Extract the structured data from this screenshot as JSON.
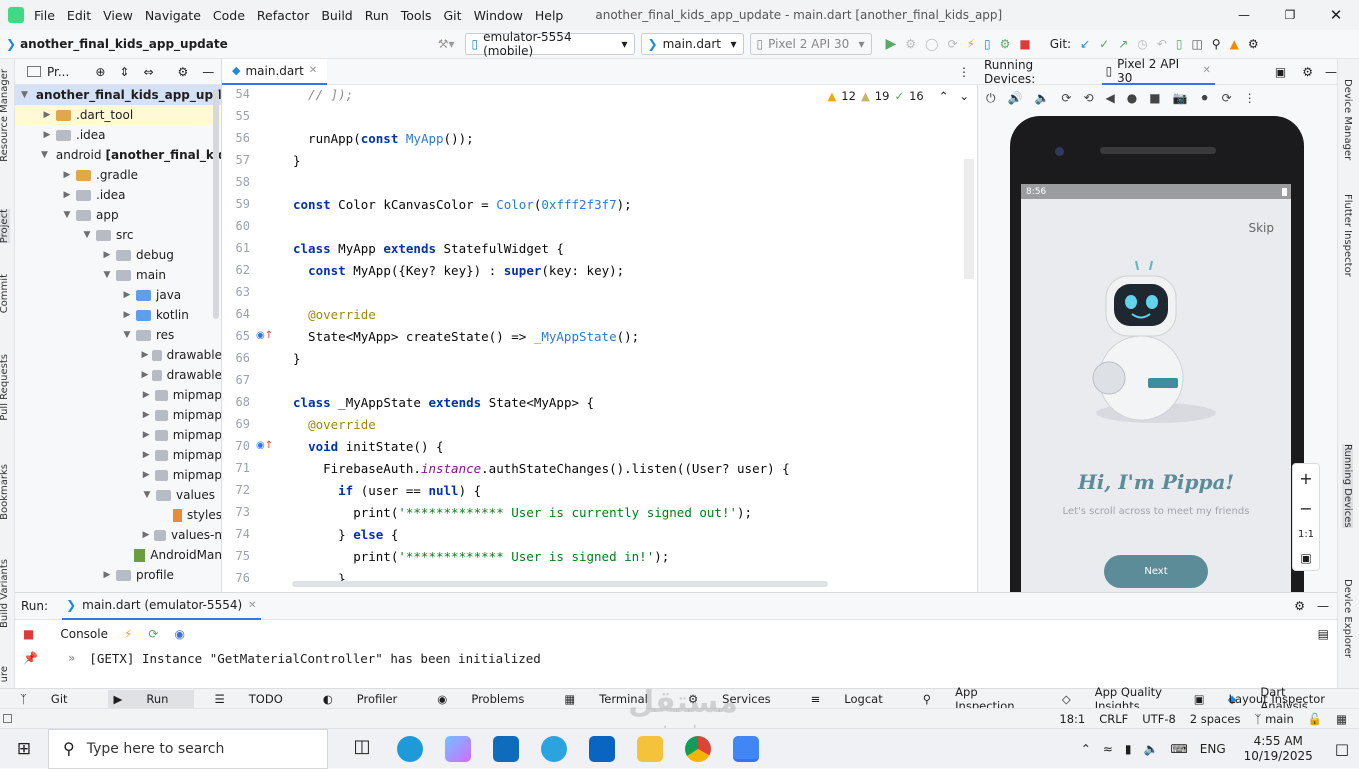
{
  "menu": [
    "File",
    "Edit",
    "View",
    "Navigate",
    "Code",
    "Refactor",
    "Build",
    "Run",
    "Tools",
    "Git",
    "Window",
    "Help"
  ],
  "window_title": "another_final_kids_app_update - main.dart [another_final_kids_app]",
  "project_name": "another_final_kids_app_update",
  "device_selector": "emulator-5554 (mobile)",
  "run_config": "main.dart",
  "avd": "Pixel 2 API 30",
  "git_label": "Git:",
  "left_strip": [
    "Resource Manager",
    "Project",
    "Commit",
    "Pull Requests",
    "Bookmarks",
    "Build Variants",
    "ure"
  ],
  "right_strip": [
    "Device Manager",
    "Flutter Inspector",
    "Running Devices",
    "Device Explorer"
  ],
  "project_panel": {
    "title": "Pr...",
    "tree": [
      {
        "label": "another_final_kids_app_update",
        "depth": 0,
        "arrow": "down",
        "kind": "module",
        "highlight": true
      },
      {
        "label": ".dart_tool",
        "depth": 1,
        "arrow": "right",
        "kind": "folder-orange",
        "highlight": true
      },
      {
        "label": ".idea",
        "depth": 1,
        "arrow": "right",
        "kind": "folder-gear"
      },
      {
        "label": "android",
        "bold": "[another_final_kids",
        "depth": 1,
        "arrow": "down",
        "kind": "folder"
      },
      {
        "label": ".gradle",
        "depth": 2,
        "arrow": "right",
        "kind": "folder-orange"
      },
      {
        "label": ".idea",
        "depth": 2,
        "arrow": "right",
        "kind": "folder-gear"
      },
      {
        "label": "app",
        "depth": 2,
        "arrow": "down",
        "kind": "folder"
      },
      {
        "label": "src",
        "depth": 3,
        "arrow": "down",
        "kind": "folder"
      },
      {
        "label": "debug",
        "depth": 4,
        "arrow": "right",
        "kind": "folder"
      },
      {
        "label": "main",
        "depth": 4,
        "arrow": "down",
        "kind": "folder"
      },
      {
        "label": "java",
        "depth": 5,
        "arrow": "right",
        "kind": "folder-blue"
      },
      {
        "label": "kotlin",
        "depth": 5,
        "arrow": "right",
        "kind": "folder-blue"
      },
      {
        "label": "res",
        "depth": 5,
        "arrow": "down",
        "kind": "folder"
      },
      {
        "label": "drawable",
        "depth": 6,
        "arrow": "right",
        "kind": "folder"
      },
      {
        "label": "drawable",
        "depth": 6,
        "arrow": "right",
        "kind": "folder"
      },
      {
        "label": "mipmap",
        "depth": 6,
        "arrow": "right",
        "kind": "folder"
      },
      {
        "label": "mipmap",
        "depth": 6,
        "arrow": "right",
        "kind": "folder"
      },
      {
        "label": "mipmap",
        "depth": 6,
        "arrow": "right",
        "kind": "folder"
      },
      {
        "label": "mipmap",
        "depth": 6,
        "arrow": "right",
        "kind": "folder"
      },
      {
        "label": "mipmap",
        "depth": 6,
        "arrow": "right",
        "kind": "folder"
      },
      {
        "label": "values",
        "depth": 6,
        "arrow": "down",
        "kind": "folder"
      },
      {
        "label": "styles",
        "depth": 7,
        "arrow": "none",
        "kind": "file-xml"
      },
      {
        "label": "values-n",
        "depth": 6,
        "arrow": "right",
        "kind": "folder"
      },
      {
        "label": "AndroidMan",
        "depth": 5,
        "arrow": "none",
        "kind": "file-mf"
      },
      {
        "label": "profile",
        "depth": 4,
        "arrow": "right",
        "kind": "folder"
      }
    ]
  },
  "editor": {
    "tab": "main.dart",
    "inspections": {
      "warnings": "12",
      "weak": "19",
      "ok": "16"
    },
    "lines": [
      {
        "n": "54",
        "html": "<span class='cm'>  // ]);</span>"
      },
      {
        "n": "55",
        "html": ""
      },
      {
        "n": "56",
        "html": "  runApp(<span class='kw'>const</span> <span class='cls'>MyApp</span>());"
      },
      {
        "n": "57",
        "html": "}"
      },
      {
        "n": "58",
        "html": ""
      },
      {
        "n": "59",
        "html": "<span class='kw'>const</span> Color kCanvasColor = <span class='cls'>Color</span>(<span class='cls'>0xfff2f3f7</span>);"
      },
      {
        "n": "60",
        "html": ""
      },
      {
        "n": "61",
        "html": "<span class='kw'>class</span> MyApp <span class='kw'>extends</span> StatefulWidget {"
      },
      {
        "n": "62",
        "html": "  <span class='kw'>const</span> MyApp({Key? key}) : <span class='kw'>super</span>(key: key);"
      },
      {
        "n": "63",
        "html": ""
      },
      {
        "n": "64",
        "html": "  <span class='ann'>@override</span>"
      },
      {
        "n": "65",
        "html": "  State&lt;MyApp&gt; createState() =&gt; <span class='cls'>_MyAppState</span>();"
      },
      {
        "n": "66",
        "html": "}"
      },
      {
        "n": "67",
        "html": ""
      },
      {
        "n": "68",
        "html": "<span class='kw'>class</span> _MyAppState <span class='kw'>extends</span> State&lt;MyApp&gt; {"
      },
      {
        "n": "69",
        "html": "  <span class='ann'>@override</span>"
      },
      {
        "n": "70",
        "html": "  <span class='kw'>void</span> initState() {"
      },
      {
        "n": "71",
        "html": "    FirebaseAuth.<span class='it'>instance</span>.authStateChanges().listen((User? user) {"
      },
      {
        "n": "72",
        "html": "      <span class='kw'>if</span> (user == <span class='kw'>null</span>) {"
      },
      {
        "n": "73",
        "html": "        print(<span class='str'>'************* User is currently signed out!'</span>);"
      },
      {
        "n": "74",
        "html": "      } <span class='kw'>else</span> {"
      },
      {
        "n": "75",
        "html": "        print(<span class='str'>'************* User is signed in!'</span>);"
      },
      {
        "n": "76",
        "html": "      }"
      }
    ]
  },
  "devices": {
    "title": "Running Devices:",
    "tab": "Pixel 2 API 30",
    "status_time": "8:56",
    "app": {
      "skip": "Skip",
      "heading": "Hi, I'm Pippa!",
      "subtitle": "Let's scroll across to meet my friends",
      "next": "Next"
    },
    "zoom_ratio": "1:1"
  },
  "run": {
    "label": "Run:",
    "tab": "main.dart (emulator-5554)",
    "console_tab": "Console",
    "log": "[GETX] Instance \"GetMaterialController\" has been initialized"
  },
  "bottom_tools": [
    "Git",
    "Run",
    "TODO",
    "Profiler",
    "Problems",
    "Terminal",
    "Services",
    "Logcat",
    "App Inspection",
    "App Quality Insights",
    "Dart Analysis"
  ],
  "layout_inspector": "Layout Inspector",
  "status": {
    "pos": "18:1",
    "crlf": "CRLF",
    "enc": "UTF-8",
    "indent": "2 spaces",
    "branch": "main"
  },
  "taskbar": {
    "search": "Type here to search",
    "lang": "ENG",
    "time": "4:55 AM",
    "date": "10/19/2025"
  },
  "watermark": {
    "main": "مستقل",
    "sub": "mostaql.com"
  }
}
